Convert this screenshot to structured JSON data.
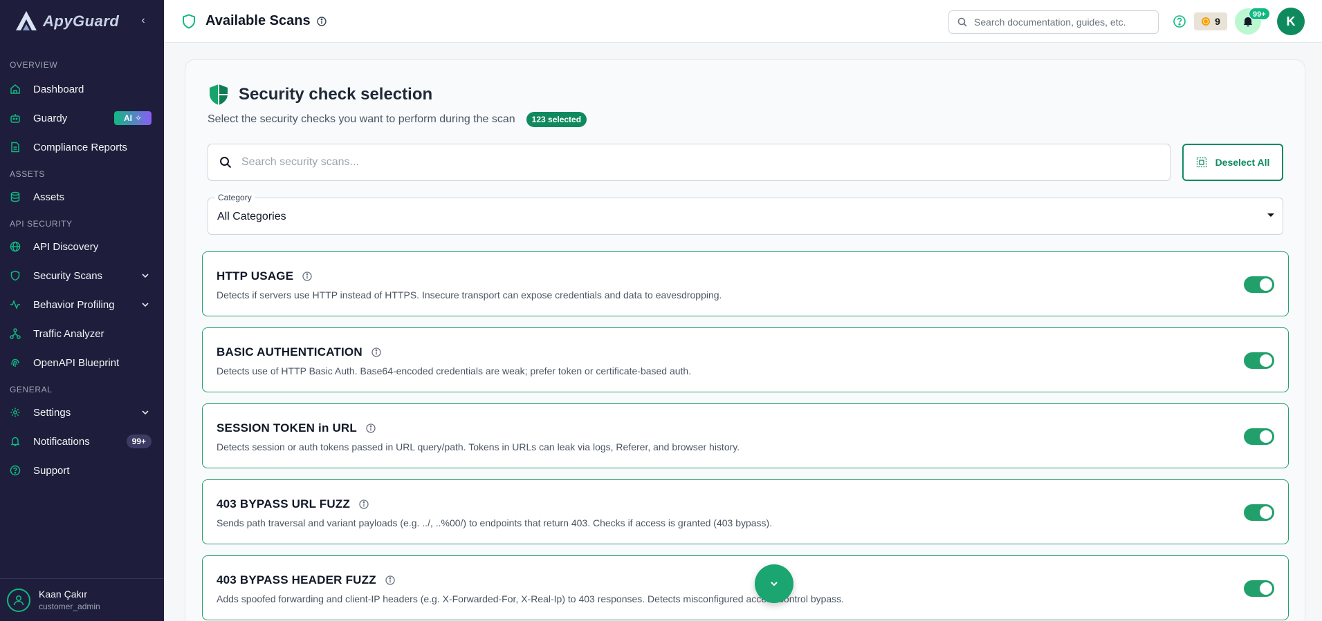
{
  "app": {
    "logo_text": "ApyGuard",
    "page_title": "Available Scans",
    "accent_color": "#0f8a5f"
  },
  "sidebar": {
    "sections": {
      "overview": "OVERVIEW",
      "assets": "ASSETS",
      "api_security": "API SECURITY",
      "general": "GENERAL"
    },
    "items": [
      {
        "label": "Dashboard",
        "icon": "home-icon"
      },
      {
        "label": "Guardy",
        "icon": "robot-icon",
        "badge": "AI"
      },
      {
        "label": "Compliance Reports",
        "icon": "document-icon"
      },
      {
        "label": "Assets",
        "icon": "database-icon"
      },
      {
        "label": "API Discovery",
        "icon": "globe-icon"
      },
      {
        "label": "Security Scans",
        "icon": "shield-icon",
        "expandable": true
      },
      {
        "label": "Behavior Profiling",
        "icon": "activity-icon",
        "expandable": true
      },
      {
        "label": "Traffic Analyzer",
        "icon": "network-icon"
      },
      {
        "label": "OpenAPI Blueprint",
        "icon": "fingerprint-icon"
      },
      {
        "label": "Settings",
        "icon": "gear-icon",
        "expandable": true
      },
      {
        "label": "Notifications",
        "icon": "bell-icon",
        "badge": "99+"
      },
      {
        "label": "Support",
        "icon": "help-icon"
      }
    ],
    "user": {
      "name": "Kaan Çakır",
      "role": "customer_admin"
    }
  },
  "topbar": {
    "search_placeholder": "Search documentation, guides, etc.",
    "credits": "9",
    "notification_count": "99+",
    "avatar_initial": "K"
  },
  "card": {
    "title": "Security check selection",
    "subtitle": "Select the security checks you want to perform during the scan",
    "selected_badge": "123 selected",
    "search_placeholder": "Search security scans...",
    "deselect_label": "Deselect All",
    "category_label": "Category",
    "category_value": "All Categories"
  },
  "scans": [
    {
      "title": "HTTP USAGE",
      "description": "Detects if servers use HTTP instead of HTTPS. Insecure transport can expose credentials and data to eavesdropping.",
      "enabled": true
    },
    {
      "title": "BASIC AUTHENTICATION",
      "description": "Detects use of HTTP Basic Auth. Base64-encoded credentials are weak; prefer token or certificate-based auth.",
      "enabled": true
    },
    {
      "title": "SESSION TOKEN in URL",
      "description": "Detects session or auth tokens passed in URL query/path. Tokens in URLs can leak via logs, Referer, and browser history.",
      "enabled": true
    },
    {
      "title": "403 BYPASS URL FUZZ",
      "description": "Sends path traversal and variant payloads (e.g. ../, ..%00/) to endpoints that return 403. Checks if access is granted (403 bypass).",
      "enabled": true
    },
    {
      "title": "403 BYPASS HEADER FUZZ",
      "description": "Adds spoofed forwarding and client-IP headers (e.g. X-Forwarded-For, X-Real-Ip) to 403 responses. Detects misconfigured access control bypass.",
      "enabled": true
    }
  ]
}
